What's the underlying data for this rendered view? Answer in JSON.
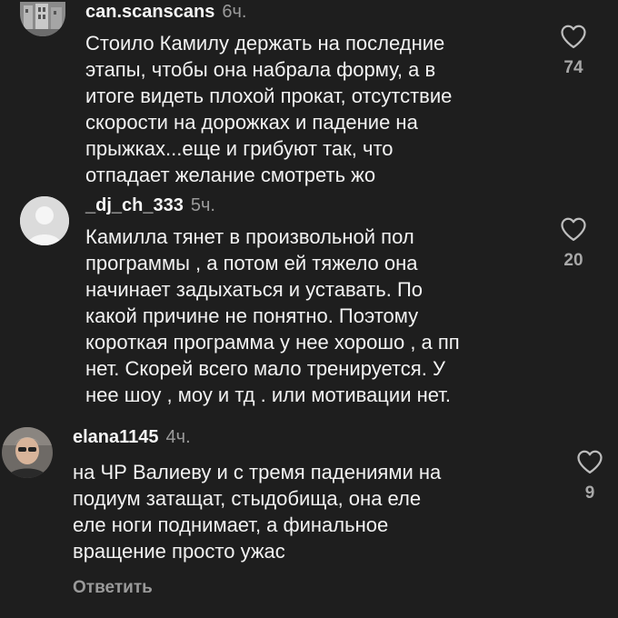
{
  "comments": [
    {
      "username": "can.scanscans",
      "time": "6ч.",
      "lines": [
        "Стоило Камилу держать на последние",
        "этапы, чтобы она набрала форму, а в",
        "итоге видеть плохой прокат, отсутствие",
        "скорости на дорожках и падение на",
        "прыжках...еще и грибуют так, что",
        "отпадает желание смотреть жо"
      ],
      "likes": "74",
      "avatar_icon": "photo-avatar-icon"
    },
    {
      "username": "_dj_ch_333",
      "time": "5ч.",
      "lines": [
        "Камилла тянет в произвольной пол",
        "программы , а потом ей тяжело она",
        "начинает задыхаться и уставать. По",
        "какой причине не понятно. Поэтому",
        "короткая программа у нее хорошо , а пп",
        "нет. Скорей всего мало тренируется. У",
        "нее шоу , моу и тд . или мотивации нет."
      ],
      "likes": "20",
      "avatar_icon": "default-avatar-icon"
    },
    {
      "username": "elana1145",
      "time": "4ч.",
      "lines": [
        "на ЧР Валиеву и с тремя  падениями на",
        "подиум затащат, стыдобища, она еле",
        "еле ноги поднимает, а финальное",
        "вращение просто ужас"
      ],
      "likes": "9",
      "avatar_icon": "photo-avatar-icon"
    }
  ],
  "reply_label": "Ответить",
  "colors": {
    "background": "#1e1e1e",
    "text": "#f2f2f2",
    "muted": "#9a9a9a"
  }
}
